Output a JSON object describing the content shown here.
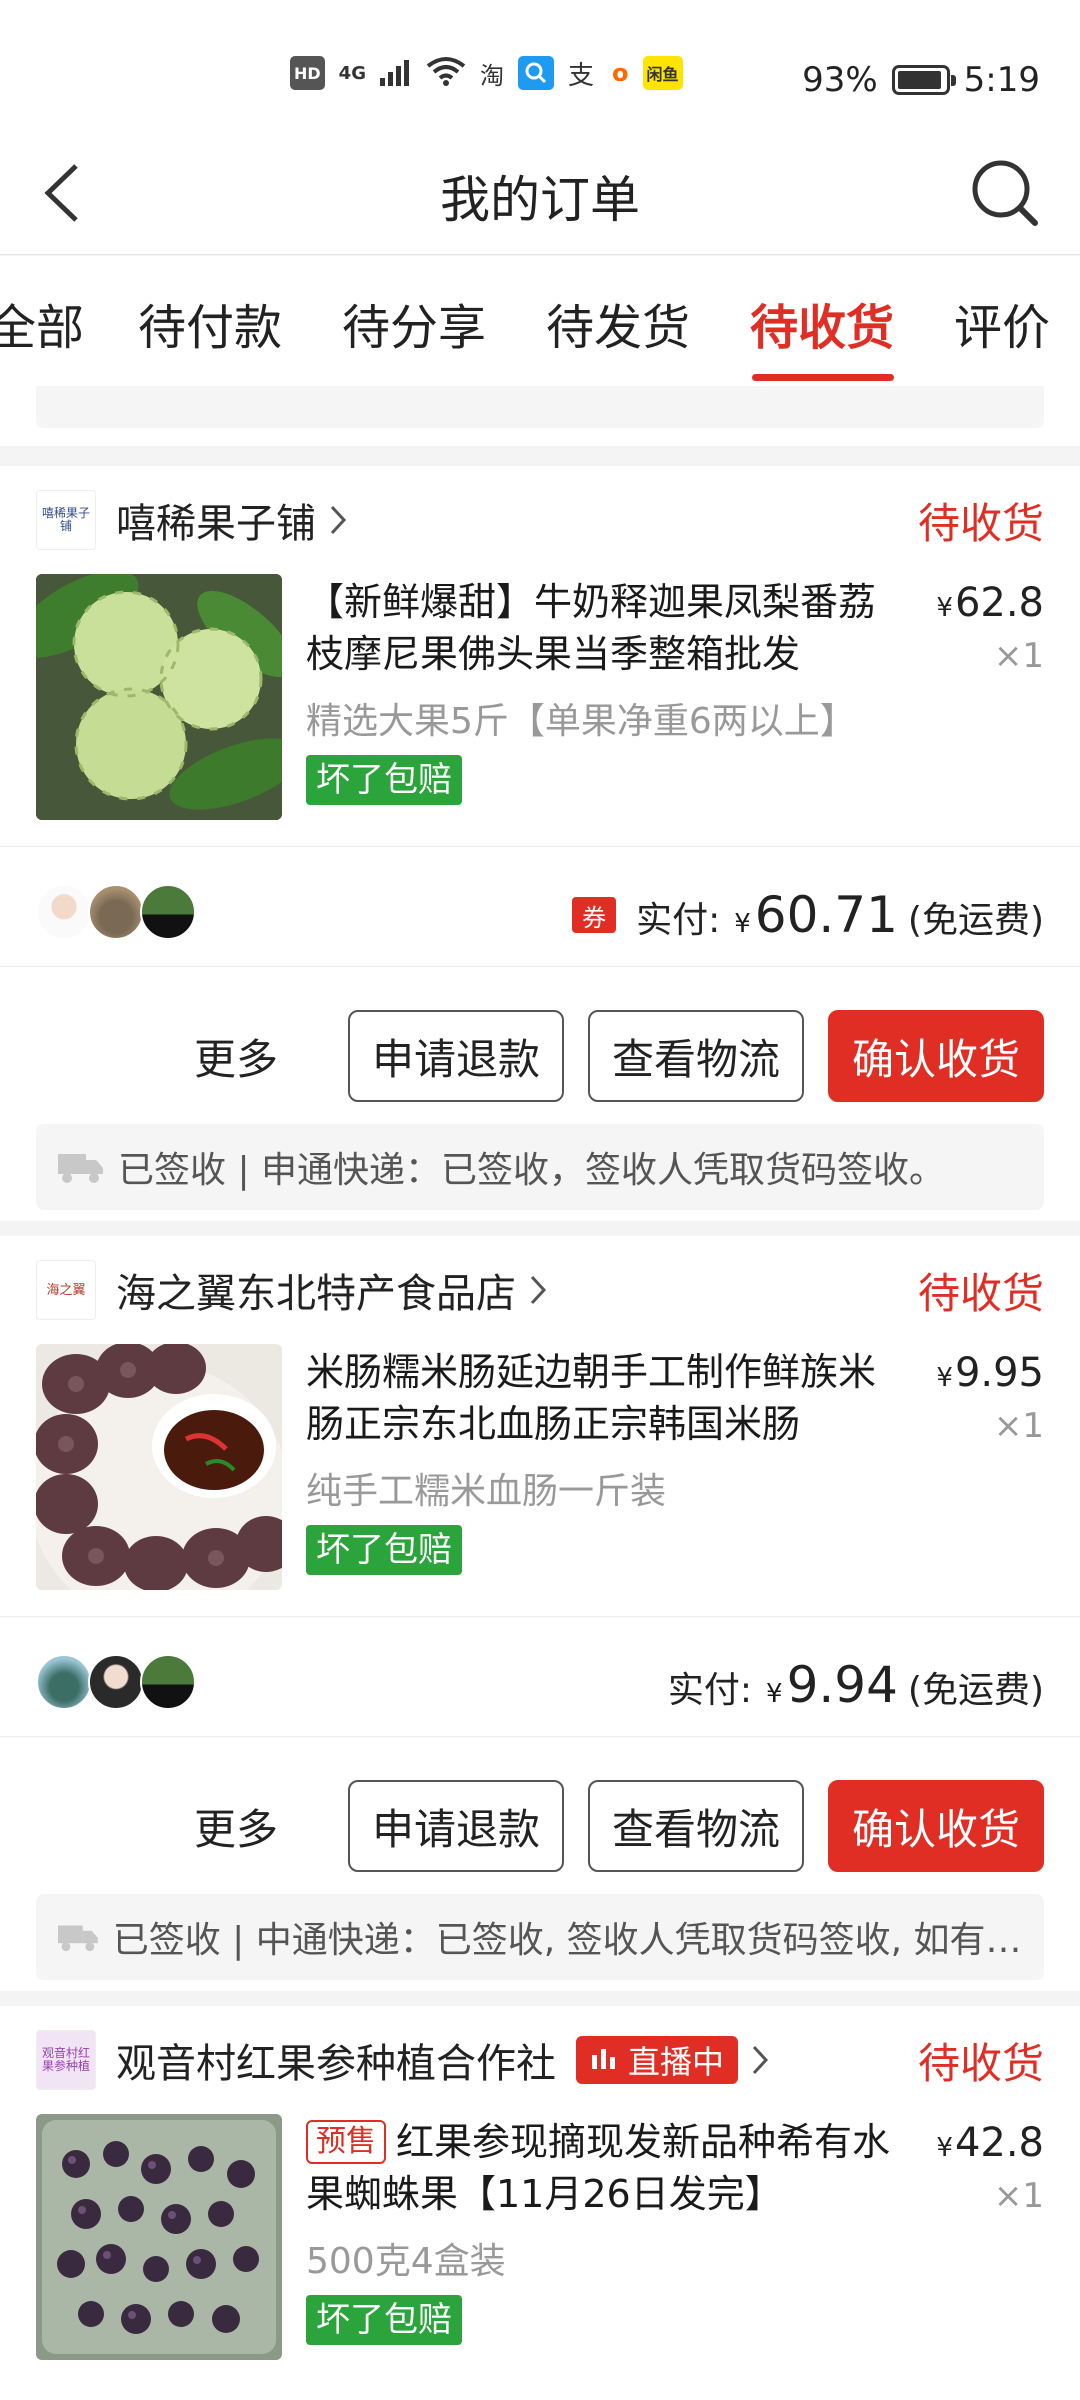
{
  "status_bar": {
    "left_icons": [
      "HD",
      "4G",
      "signal-icon",
      "wifi-icon",
      "淘",
      "search-app-icon",
      "支",
      "o",
      "闲鱼"
    ],
    "battery": "93%",
    "time": "5:19"
  },
  "header": {
    "title": "我的订单"
  },
  "tabs": [
    {
      "label": "全部"
    },
    {
      "label": "待付款"
    },
    {
      "label": "待分享"
    },
    {
      "label": "待发货"
    },
    {
      "label": "待收货",
      "active": true
    },
    {
      "label": "评价"
    }
  ],
  "orders": [
    {
      "shop_name": "嘻稀果子铺",
      "shop_logo_text": "嘻稀果子铺",
      "status": "待收货",
      "product_title": "【新鲜爆甜】牛奶释迦果凤梨番荔枝摩尼果佛头果当季整箱批发",
      "spec": "精选大果5斤【单果净重6两以上】",
      "guarantee": "坏了包赔",
      "price": "62.8",
      "qty": "×1",
      "paid_label": "实付:",
      "paid_amount": "60.71",
      "paid_note": "(免运费)",
      "coupon": "券",
      "more": "更多",
      "btn_refund": "申请退款",
      "btn_logistics": "查看物流",
      "btn_confirm": "确认收货",
      "logistics": "已签收 | 申通快递：已签收，签收人凭取货码签收。"
    },
    {
      "shop_name": "海之翼东北特产食品店",
      "shop_logo_text": "海之翼",
      "status": "待收货",
      "product_title": "米肠糯米肠延边朝手工制作鲜族米肠正宗东北血肠正宗韩国米肠",
      "spec": "纯手工糯米血肠一斤装",
      "guarantee": "坏了包赔",
      "price": "9.95",
      "qty": "×1",
      "paid_label": "实付:",
      "paid_amount": "9.94",
      "paid_note": "(免运费)",
      "more": "更多",
      "btn_refund": "申请退款",
      "btn_logistics": "查看物流",
      "btn_confirm": "确认收货",
      "logistics": "已签收 | 中通快递：已签收, 签收人凭取货码签收, 如有疑问请联系"
    },
    {
      "shop_name": "观音村红果参种植合作社",
      "shop_logo_text": "观音村红果参种植",
      "live_badge": "直播中",
      "status": "待收货",
      "presale": "预售",
      "product_title": "红果参现摘现发新品种希有水果蜘蛛果【11月26日发完】",
      "spec": "500克4盒装",
      "guarantee": "坏了包赔",
      "price": "42.8",
      "qty": "×1"
    }
  ],
  "yen_symbol": "¥",
  "colors": {
    "accent": "#e02e24",
    "guarantee": "#2aa43b"
  }
}
